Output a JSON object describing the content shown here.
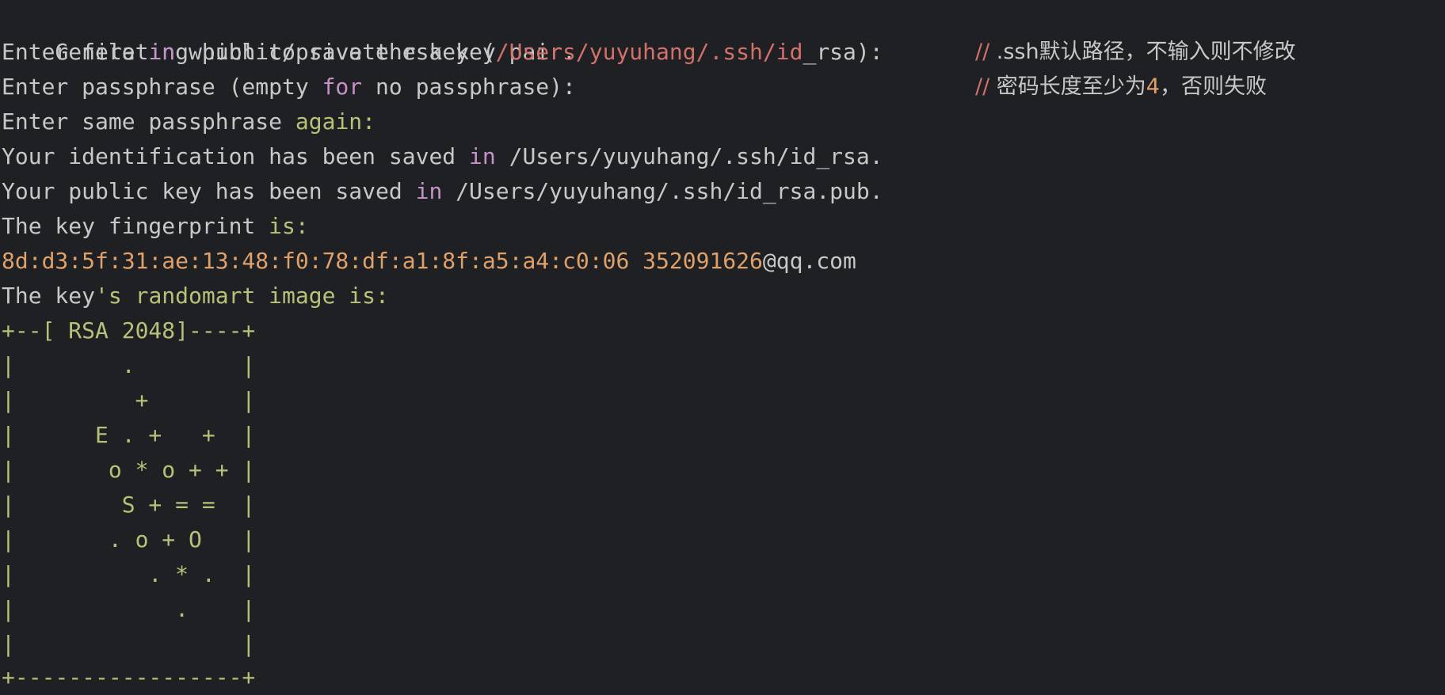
{
  "terminal": {
    "line1": "Generating public/private rsa key pair.",
    "line2": {
      "a": "Enter file ",
      "kw": "in",
      "b": " which to save the key (",
      "path": "/Users/yuyuhang/.ssh/id",
      "c": "_rsa):"
    },
    "comment1": {
      "slashes": "//",
      "text": " .ssh默认路径，不输入则不修改"
    },
    "line3": {
      "a": "Enter passphrase (empty ",
      "kw": "for",
      "b": " no passphrase):"
    },
    "comment2": {
      "slashes": "//",
      "text_a": " 密码长度至少为",
      "num": "4",
      "text_b": "，否则失败"
    },
    "line4": {
      "a": "Enter same passphrase ",
      "b": "again:"
    },
    "line5": {
      "a": "Your identification has been saved ",
      "kw": "in",
      "b": " /Users/yuyuhang/.ssh/id_rsa."
    },
    "line6": {
      "a": "Your public key has been saved ",
      "kw": "in",
      "b": " /Users/yuyuhang/.ssh/id_rsa.pub."
    },
    "line7": {
      "a": "The key fingerprint ",
      "b": "is:"
    },
    "line8": {
      "fingerprint": "8d:d3:5f:31:ae:13:48:f0:78:df:a1:8f:a5:a4:c0:06 352091626",
      "email": "@qq.com"
    },
    "line9": {
      "a": "The key",
      "b": "'s randomart image is:"
    },
    "randomart": [
      "+--[ RSA 2048]----+",
      "|        .        |",
      "|         +       |",
      "|      E . +   +  |",
      "|       o * o + + |",
      "|        S + = =  |",
      "|       . o + O   |",
      "|          . * .  |",
      "|            .    |",
      "|                 |",
      "+-----------------+"
    ]
  }
}
